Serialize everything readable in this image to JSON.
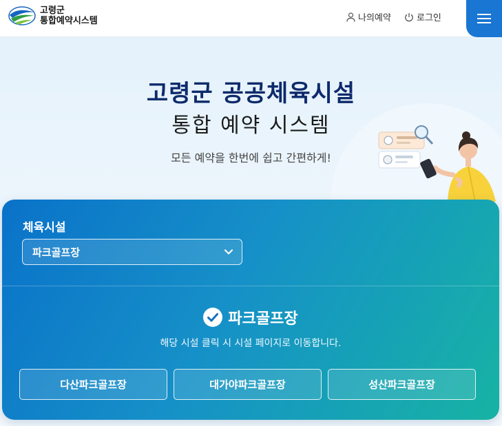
{
  "header": {
    "logo_line1": "고령군",
    "logo_line2": "통합예약시스템",
    "my_reservation": "나의예약",
    "login": "로그인",
    "icons": {
      "user": "user-icon",
      "power": "power-icon",
      "menu": "hamburger-menu-icon"
    },
    "menu_color": "#1976d2"
  },
  "hero": {
    "title_line1": "고령군 공공체육시설",
    "title_line2": "통합 예약 시스템",
    "subtitle": "모든 예약을 한번에 쉽고 간편하게!"
  },
  "panel": {
    "facility_label": "체육시설",
    "facility_selected": "파크골프장",
    "selected_title": "파크골프장",
    "guide": "해당 시설 클릭 시 시설 페이지로 이동합니다.",
    "courses": [
      {
        "label": "다산파크골프장"
      },
      {
        "label": "대가야파크골프장"
      },
      {
        "label": "성산파크골프장"
      }
    ],
    "gradient_start": "#0a72c9",
    "gradient_end": "#17b3a4"
  }
}
